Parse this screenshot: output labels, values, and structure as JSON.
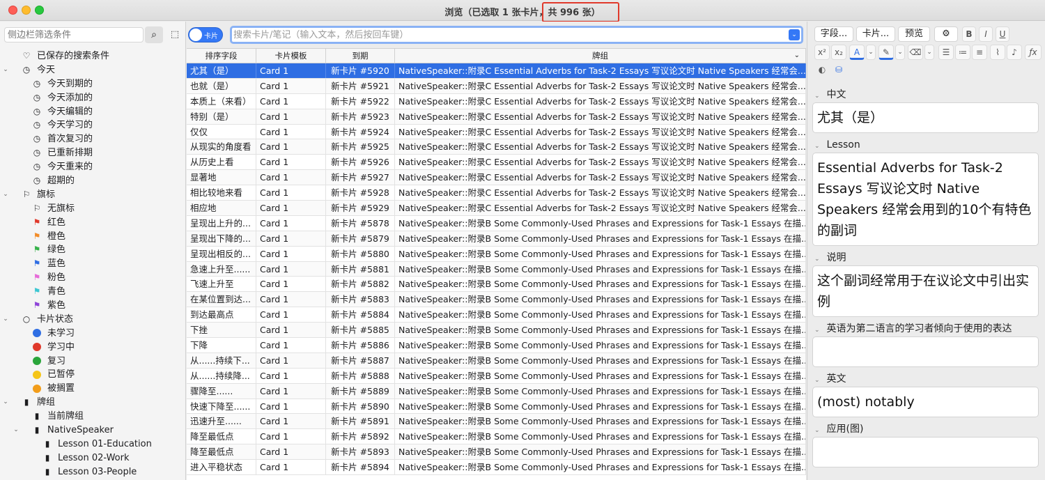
{
  "window": {
    "title_prefix": "浏览（已选取 1 张卡片，",
    "title_count": "共 996 张）"
  },
  "sidebar": {
    "search_placeholder": "侧边栏筛选条件",
    "items": [
      {
        "label": "已保存的搜索条件",
        "icon": "heart-icon",
        "glyph": "♡",
        "level": 0,
        "chev": ""
      },
      {
        "label": "今天",
        "icon": "clock-icon",
        "glyph": "◷",
        "level": 0,
        "chev": "⌄"
      },
      {
        "label": "今天到期的",
        "icon": "clock-icon",
        "glyph": "◷",
        "level": 1,
        "chev": ""
      },
      {
        "label": "今天添加的",
        "icon": "clock-icon",
        "glyph": "◷",
        "level": 1,
        "chev": ""
      },
      {
        "label": "今天编辑的",
        "icon": "clock-icon",
        "glyph": "◷",
        "level": 1,
        "chev": ""
      },
      {
        "label": "今天学习的",
        "icon": "clock-icon",
        "glyph": "◷",
        "level": 1,
        "chev": ""
      },
      {
        "label": "首次复习的",
        "icon": "clock-icon",
        "glyph": "◷",
        "level": 1,
        "chev": ""
      },
      {
        "label": "已重新排期",
        "icon": "clock-icon",
        "glyph": "◷",
        "level": 1,
        "chev": ""
      },
      {
        "label": "今天重来的",
        "icon": "clock-icon",
        "glyph": "◷",
        "level": 1,
        "chev": ""
      },
      {
        "label": "超期的",
        "icon": "clock-icon",
        "glyph": "◷",
        "level": 1,
        "chev": ""
      },
      {
        "label": "旗标",
        "icon": "flag-outline-icon",
        "glyph": "⚐",
        "level": 0,
        "chev": "⌄"
      },
      {
        "label": "无旗标",
        "icon": "no-flag-icon",
        "glyph": "⚐",
        "level": 1,
        "chev": ""
      },
      {
        "label": "红色",
        "icon": "red-flag-icon",
        "glyph": "⚑",
        "color": "#e0392b",
        "level": 1,
        "chev": ""
      },
      {
        "label": "橙色",
        "icon": "orange-flag-icon",
        "glyph": "⚑",
        "color": "#f28c28",
        "level": 1,
        "chev": ""
      },
      {
        "label": "绿色",
        "icon": "green-flag-icon",
        "glyph": "⚑",
        "color": "#36b24a",
        "level": 1,
        "chev": ""
      },
      {
        "label": "蓝色",
        "icon": "blue-flag-icon",
        "glyph": "⚑",
        "color": "#2f6ee3",
        "level": 1,
        "chev": ""
      },
      {
        "label": "粉色",
        "icon": "pink-flag-icon",
        "glyph": "⚑",
        "color": "#e66bd8",
        "level": 1,
        "chev": ""
      },
      {
        "label": "青色",
        "icon": "cyan-flag-icon",
        "glyph": "⚑",
        "color": "#3cc7d2",
        "level": 1,
        "chev": ""
      },
      {
        "label": "紫色",
        "icon": "purple-flag-icon",
        "glyph": "⚑",
        "color": "#8e44d8",
        "level": 1,
        "chev": ""
      },
      {
        "label": "卡片状态",
        "icon": "circle-outline-icon",
        "glyph": "○",
        "level": 0,
        "chev": "⌄"
      },
      {
        "label": "未学习",
        "icon": "blue-dot-icon",
        "dot": "#2f6ee3",
        "level": 1,
        "chev": ""
      },
      {
        "label": "学习中",
        "icon": "red-dot-icon",
        "dot": "#e0392b",
        "level": 1,
        "chev": ""
      },
      {
        "label": "复习",
        "icon": "green-dot-icon",
        "dot": "#2aa53b",
        "level": 1,
        "chev": ""
      },
      {
        "label": "已暂停",
        "icon": "yellow-dot-icon",
        "dot": "#f5c518",
        "level": 1,
        "chev": ""
      },
      {
        "label": "被搁置",
        "icon": "orange-dot-icon",
        "dot": "#f29d1a",
        "level": 1,
        "chev": ""
      },
      {
        "label": "牌组",
        "icon": "deck-icon",
        "glyph": "▮",
        "level": 0,
        "chev": "⌄"
      },
      {
        "label": "当前牌组",
        "icon": "current-deck-icon",
        "glyph": "▮",
        "level": 1,
        "chev": ""
      },
      {
        "label": "NativeSpeaker",
        "icon": "deck-icon",
        "glyph": "▮",
        "level": 1,
        "chev": "⌄"
      },
      {
        "label": "Lesson 01-Education",
        "icon": "deck-icon",
        "glyph": "▮",
        "level": 2,
        "chev": ""
      },
      {
        "label": "Lesson 02-Work",
        "icon": "deck-icon",
        "glyph": "▮",
        "level": 2,
        "chev": ""
      },
      {
        "label": "Lesson 03-People",
        "icon": "deck-icon",
        "glyph": "▮",
        "level": 2,
        "chev": ""
      }
    ]
  },
  "toolbar": {
    "toggle_label": "卡片",
    "search_placeholder": "搜索卡片/笔记（输入文本，然后按回车键）"
  },
  "table": {
    "columns": [
      "排序字段",
      "卡片模板",
      "到期",
      "牌组"
    ],
    "rows": [
      [
        "尤其（是）",
        "Card 1",
        "新卡片 #5920",
        "NativeSpeaker::附录C Essential Adverbs for Task-2 Essays 写议论文时 Native Speakers 经常会..."
      ],
      [
        "也就（是）",
        "Card 1",
        "新卡片 #5921",
        "NativeSpeaker::附录C Essential Adverbs for Task-2 Essays 写议论文时 Native Speakers 经常会..."
      ],
      [
        "本质上（来看）",
        "Card 1",
        "新卡片 #5922",
        "NativeSpeaker::附录C Essential Adverbs for Task-2 Essays 写议论文时 Native Speakers 经常会..."
      ],
      [
        "特别（是）",
        "Card 1",
        "新卡片 #5923",
        "NativeSpeaker::附录C Essential Adverbs for Task-2 Essays 写议论文时 Native Speakers 经常会..."
      ],
      [
        "仅仅",
        "Card 1",
        "新卡片 #5924",
        "NativeSpeaker::附录C Essential Adverbs for Task-2 Essays 写议论文时 Native Speakers 经常会..."
      ],
      [
        "从现实的角度看",
        "Card 1",
        "新卡片 #5925",
        "NativeSpeaker::附录C Essential Adverbs for Task-2 Essays 写议论文时 Native Speakers 经常会..."
      ],
      [
        "从历史上看",
        "Card 1",
        "新卡片 #5926",
        "NativeSpeaker::附录C Essential Adverbs for Task-2 Essays 写议论文时 Native Speakers 经常会..."
      ],
      [
        "显著地",
        "Card 1",
        "新卡片 #5927",
        "NativeSpeaker::附录C Essential Adverbs for Task-2 Essays 写议论文时 Native Speakers 经常会..."
      ],
      [
        "相比较地来看",
        "Card 1",
        "新卡片 #5928",
        "NativeSpeaker::附录C Essential Adverbs for Task-2 Essays 写议论文时 Native Speakers 经常会..."
      ],
      [
        "相应地",
        "Card 1",
        "新卡片 #5929",
        "NativeSpeaker::附录C Essential Adverbs for Task-2 Essays 写议论文时 Native Speakers 经常会..."
      ],
      [
        "呈现出上升的...",
        "Card 1",
        "新卡片 #5878",
        "NativeSpeaker::附录B Some Commonly-Used Phrases and Expressions for Task-1 Essays 在描..."
      ],
      [
        "呈现出下降的...",
        "Card 1",
        "新卡片 #5879",
        "NativeSpeaker::附录B Some Commonly-Used Phrases and Expressions for Task-1 Essays 在描..."
      ],
      [
        "呈现出相反的...",
        "Card 1",
        "新卡片 #5880",
        "NativeSpeaker::附录B Some Commonly-Used Phrases and Expressions for Task-1 Essays 在描..."
      ],
      [
        "急速上升至......",
        "Card 1",
        "新卡片 #5881",
        "NativeSpeaker::附录B Some Commonly-Used Phrases and Expressions for Task-1 Essays 在描..."
      ],
      [
        "飞速上升至",
        "Card 1",
        "新卡片 #5882",
        "NativeSpeaker::附录B Some Commonly-Used Phrases and Expressions for Task-1 Essays 在描..."
      ],
      [
        "在某位置到达...",
        "Card 1",
        "新卡片 #5883",
        "NativeSpeaker::附录B Some Commonly-Used Phrases and Expressions for Task-1 Essays 在描..."
      ],
      [
        "到达最高点",
        "Card 1",
        "新卡片 #5884",
        "NativeSpeaker::附录B Some Commonly-Used Phrases and Expressions for Task-1 Essays 在描..."
      ],
      [
        "下挫",
        "Card 1",
        "新卡片 #5885",
        "NativeSpeaker::附录B Some Commonly-Used Phrases and Expressions for Task-1 Essays 在描..."
      ],
      [
        "下降",
        "Card 1",
        "新卡片 #5886",
        "NativeSpeaker::附录B Some Commonly-Used Phrases and Expressions for Task-1 Essays 在描..."
      ],
      [
        "从......持续下...",
        "Card 1",
        "新卡片 #5887",
        "NativeSpeaker::附录B Some Commonly-Used Phrases and Expressions for Task-1 Essays 在描..."
      ],
      [
        "从......持续降...",
        "Card 1",
        "新卡片 #5888",
        "NativeSpeaker::附录B Some Commonly-Used Phrases and Expressions for Task-1 Essays 在描..."
      ],
      [
        "骤降至......",
        "Card 1",
        "新卡片 #5889",
        "NativeSpeaker::附录B Some Commonly-Used Phrases and Expressions for Task-1 Essays 在描..."
      ],
      [
        "快速下降至......",
        "Card 1",
        "新卡片 #5890",
        "NativeSpeaker::附录B Some Commonly-Used Phrases and Expressions for Task-1 Essays 在描..."
      ],
      [
        "迅速升至......",
        "Card 1",
        "新卡片 #5891",
        "NativeSpeaker::附录B Some Commonly-Used Phrases and Expressions for Task-1 Essays 在描..."
      ],
      [
        "降至最低点",
        "Card 1",
        "新卡片 #5892",
        "NativeSpeaker::附录B Some Commonly-Used Phrases and Expressions for Task-1 Essays 在描..."
      ],
      [
        "降至最低点",
        "Card 1",
        "新卡片 #5893",
        "NativeSpeaker::附录B Some Commonly-Used Phrases and Expressions for Task-1 Essays 在描..."
      ],
      [
        "进入平稳状态",
        "Card 1",
        "新卡片 #5894",
        "NativeSpeaker::附录B Some Commonly-Used Phrases and Expressions for Task-1 Essays 在描..."
      ]
    ]
  },
  "editor": {
    "buttons": [
      "字段...",
      "卡片...",
      "预览"
    ],
    "fields": [
      {
        "label": "中文",
        "value": "尤其（是）"
      },
      {
        "label": "Lesson",
        "value": "Essential Adverbs for Task-2 Essays 写议论文时 Native Speakers 经常会用到的10个有特色的副词"
      },
      {
        "label": "说明",
        "value": "这个副词经常用于在议论文中引出实例"
      },
      {
        "label": "英语为第二语言的学习者倾向于使用的表达",
        "value": ""
      },
      {
        "label": "英文",
        "value": "(most) notably"
      },
      {
        "label": "应用(图)",
        "value": ""
      }
    ]
  }
}
